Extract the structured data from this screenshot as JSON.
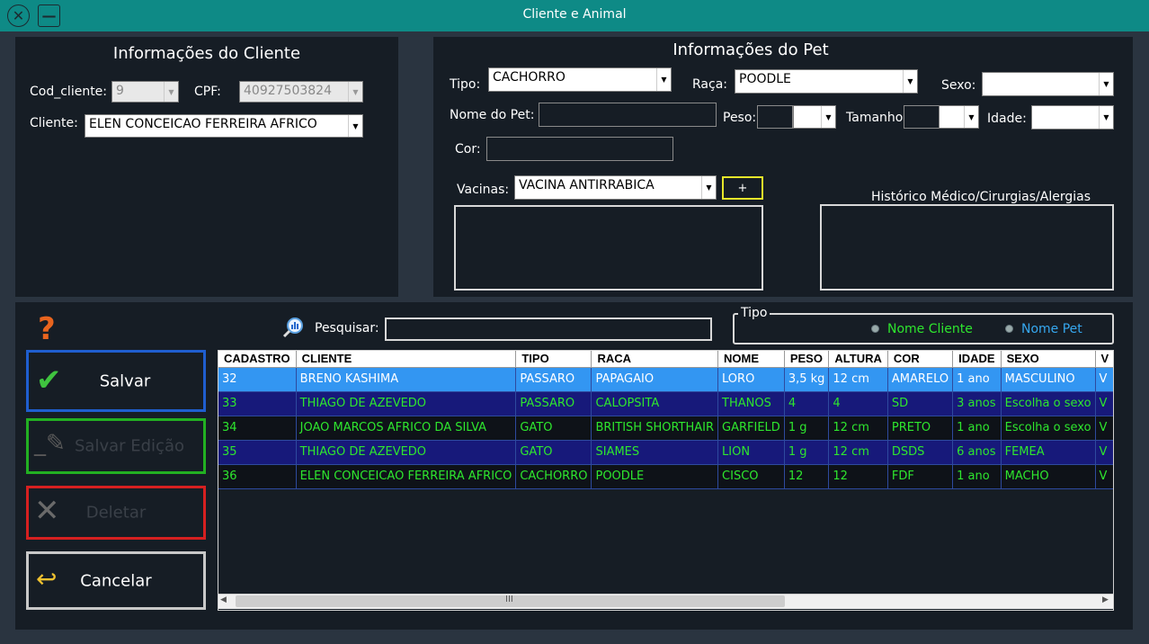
{
  "window": {
    "title": "Cliente e Animal"
  },
  "cliente": {
    "title": "Informações do Cliente",
    "cod_label": "Cod_cliente:",
    "cod_value": "9",
    "cpf_label": "CPF:",
    "cpf_value": "40927503824",
    "cliente_label": "Cliente:",
    "cliente_value": "ELEN CONCEICAO FERREIRA AFRICO"
  },
  "pet": {
    "title": "Informações do Pet",
    "tipo_label": "Tipo:",
    "tipo_value": "CACHORRO",
    "raca_label": "Raça:",
    "raca_value": "POODLE",
    "sexo_label": "Sexo:",
    "sexo_value": "",
    "nome_label": "Nome do Pet:",
    "nome_value": "",
    "peso_label": "Peso:",
    "tamanho_label": "Tamanho:",
    "idade_label": "Idade:",
    "cor_label": "Cor:",
    "cor_value": "",
    "vacinas_label": "Vacinas:",
    "vacinas_value": "VACINA ANTIRRABICA",
    "add_label": "+",
    "historico_label": "Histórico Médico/Cirurgias/Alergias"
  },
  "actions": {
    "help_label": "?",
    "salvar": "Salvar",
    "salvar_edicao": "Salvar Edição",
    "deletar": "Deletar",
    "cancelar": "Cancelar"
  },
  "search": {
    "label": "Pesquisar:",
    "value": ""
  },
  "filter": {
    "group_label": "Tipo",
    "option1": "Nome Cliente",
    "option2": "Nome Pet"
  },
  "table": {
    "columns": [
      "CADASTRO",
      "CLIENTE",
      "TIPO",
      "RACA",
      "NOME",
      "PESO",
      "ALTURA",
      "COR",
      "IDADE",
      "SEXO",
      "V"
    ],
    "rows": [
      [
        "32",
        "BRENO KASHIMA",
        "PASSARO",
        "PAPAGAIO",
        "LORO",
        "3,5 kg",
        "12 cm",
        "AMARELO",
        "1 ano",
        "MASCULINO",
        "V"
      ],
      [
        "33",
        "THIAGO DE AZEVEDO",
        "PASSARO",
        "CALOPSITA",
        "THANOS",
        "4",
        "4",
        "SD",
        "3 anos",
        "Escolha o sexo",
        "V"
      ],
      [
        "34",
        "JOAO MARCOS AFRICO DA SILVA",
        "GATO",
        "BRITISH SHORTHAIR",
        "GARFIELD",
        "1 g",
        "12 cm",
        "PRETO",
        "1 ano",
        "Escolha o sexo",
        "V"
      ],
      [
        "35",
        "THIAGO DE AZEVEDO",
        "GATO",
        "SIAMES",
        "LION",
        "1 g",
        "12 cm",
        "DSDS",
        "6 anos",
        "FEMEA",
        "V"
      ],
      [
        "36",
        "ELEN CONCEICAO FERREIRA AFRICO",
        "CACHORRO",
        "POODLE",
        "CISCO",
        "12",
        "12",
        "FDF",
        "1 ano",
        "MACHO",
        "V"
      ]
    ]
  },
  "scrollbar": {
    "grip": "III"
  }
}
